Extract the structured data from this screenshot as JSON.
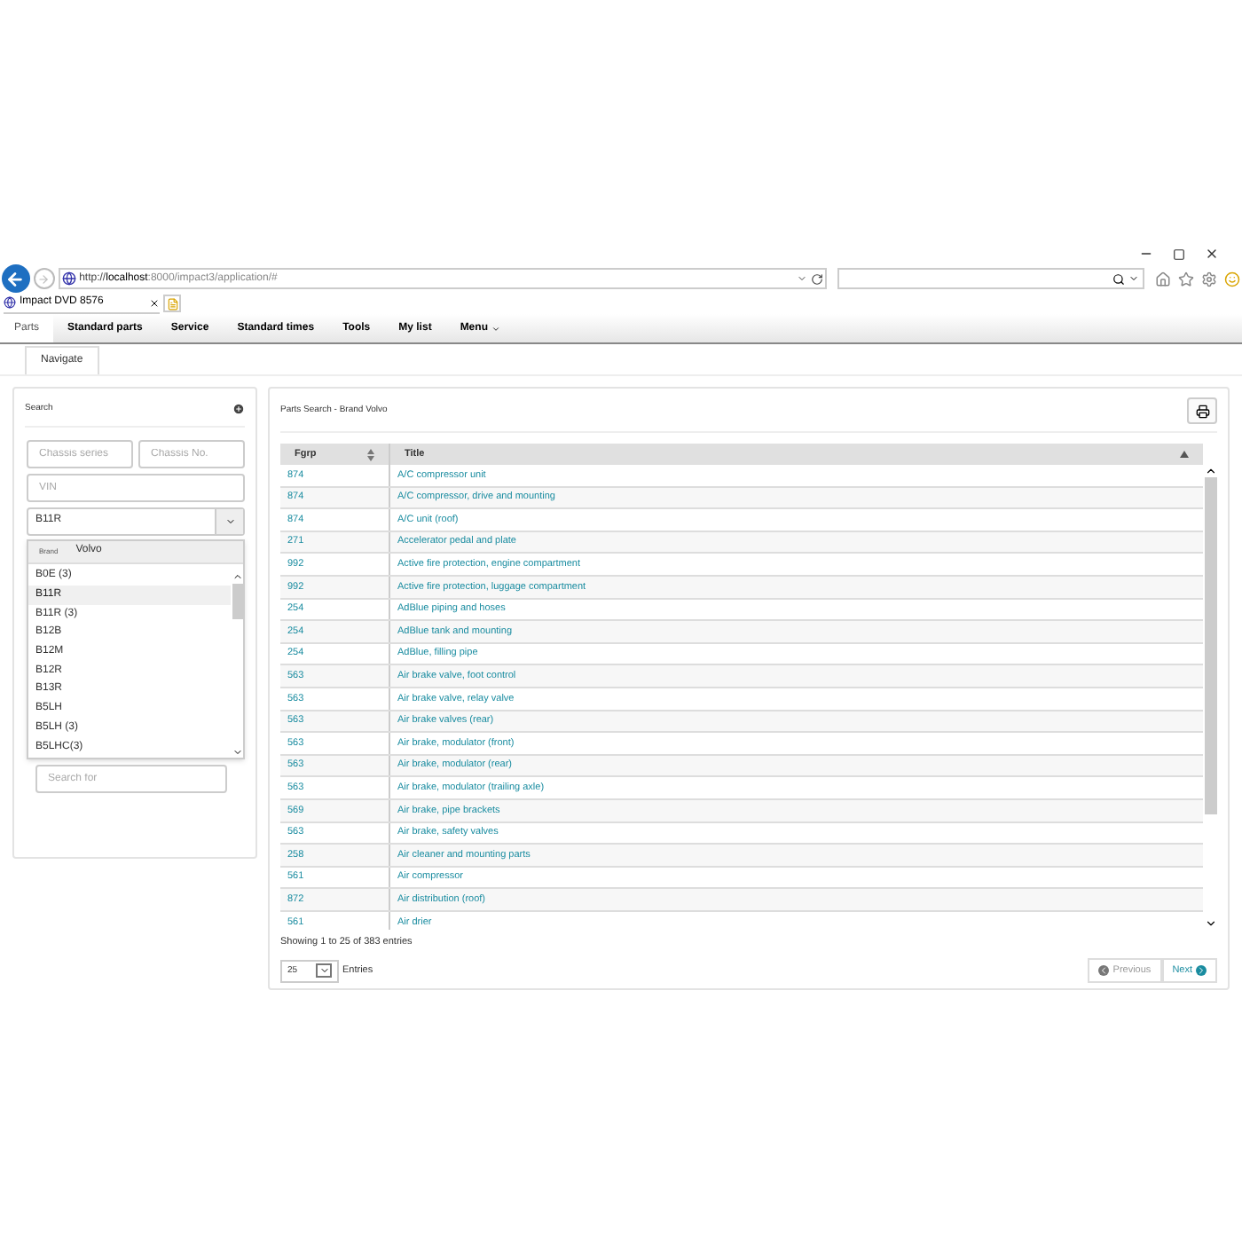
{
  "browser": {
    "address_prefix": "http://",
    "address_host": "localhost",
    "address_rest": ":8000/impact3/application/#",
    "tab_title": "Impact DVD 8576"
  },
  "nav": [
    {
      "label": "Parts",
      "selected": true,
      "kind": "plain"
    },
    {
      "label": "Standard parts",
      "selected": false,
      "kind": "plain"
    },
    {
      "label": "Service",
      "selected": false,
      "kind": "plain"
    },
    {
      "label": "Standard times",
      "selected": false,
      "kind": "plain"
    },
    {
      "label": "Tools",
      "selected": false,
      "kind": "plain"
    },
    {
      "label": "My list",
      "selected": false,
      "kind": "plain"
    },
    {
      "label": "Menu",
      "selected": false,
      "kind": "menu"
    }
  ],
  "subtabs": [
    {
      "label": "Navigate",
      "selected": true
    }
  ],
  "search_panel": {
    "title": "Search",
    "chassis_series": {
      "placeholder": "Chassis series"
    },
    "chassis_no": {
      "placeholder": "Chassis No."
    },
    "vin": {
      "placeholder": "VIN"
    },
    "model": {
      "value": "B11R"
    },
    "dropdown": {
      "header_label": "Brand",
      "header_value": "Volvo",
      "options": [
        {
          "label": "B0E (3)",
          "selected": false
        },
        {
          "label": "B11R",
          "selected": true
        },
        {
          "label": "B11R (3)",
          "selected": false
        },
        {
          "label": "B12B",
          "selected": false
        },
        {
          "label": "B12M",
          "selected": false
        },
        {
          "label": "B12R",
          "selected": false
        },
        {
          "label": "B13R",
          "selected": false
        },
        {
          "label": "B5LH",
          "selected": false
        },
        {
          "label": "B5LH (3)",
          "selected": false
        },
        {
          "label": "B5LHC(3)",
          "selected": false
        }
      ]
    },
    "search_for": {
      "placeholder": "Search for"
    }
  },
  "results": {
    "title": "Parts Search - Brand Volvo",
    "columns": [
      {
        "label": "Fgrp",
        "sorted": false
      },
      {
        "label": "Title",
        "sorted": true
      }
    ],
    "rows": [
      {
        "fgrp": "874",
        "title": "A/C compressor unit"
      },
      {
        "fgrp": "874",
        "title": "A/C compressor, drive and mounting"
      },
      {
        "fgrp": "874",
        "title": "A/C unit (roof)"
      },
      {
        "fgrp": "271",
        "title": "Accelerator pedal and plate"
      },
      {
        "fgrp": "992",
        "title": "Active fire protection, engine compartment"
      },
      {
        "fgrp": "992",
        "title": "Active fire protection, luggage compartment"
      },
      {
        "fgrp": "254",
        "title": "AdBlue piping and hoses"
      },
      {
        "fgrp": "254",
        "title": "AdBlue tank and mounting"
      },
      {
        "fgrp": "254",
        "title": "AdBlue, filling pipe"
      },
      {
        "fgrp": "563",
        "title": "Air brake valve, foot control"
      },
      {
        "fgrp": "563",
        "title": "Air brake valve, relay valve"
      },
      {
        "fgrp": "563",
        "title": "Air brake valves (rear)"
      },
      {
        "fgrp": "563",
        "title": "Air brake, modulator (front)"
      },
      {
        "fgrp": "563",
        "title": "Air brake, modulator (rear)"
      },
      {
        "fgrp": "563",
        "title": "Air brake, modulator (trailing axle)"
      },
      {
        "fgrp": "569",
        "title": "Air brake, pipe brackets"
      },
      {
        "fgrp": "563",
        "title": "Air brake, safety valves"
      },
      {
        "fgrp": "258",
        "title": "Air cleaner and mounting parts"
      },
      {
        "fgrp": "561",
        "title": "Air compressor"
      },
      {
        "fgrp": "872",
        "title": "Air distribution (roof)"
      },
      {
        "fgrp": "561",
        "title": "Air drier"
      }
    ],
    "info": "Showing 1 to 25 of 383 entries",
    "page_size": "25",
    "page_size_label": "Entries",
    "buttons": [
      {
        "label": "Previous",
        "disabled": true
      },
      {
        "label": "Next",
        "disabled": false
      }
    ]
  }
}
